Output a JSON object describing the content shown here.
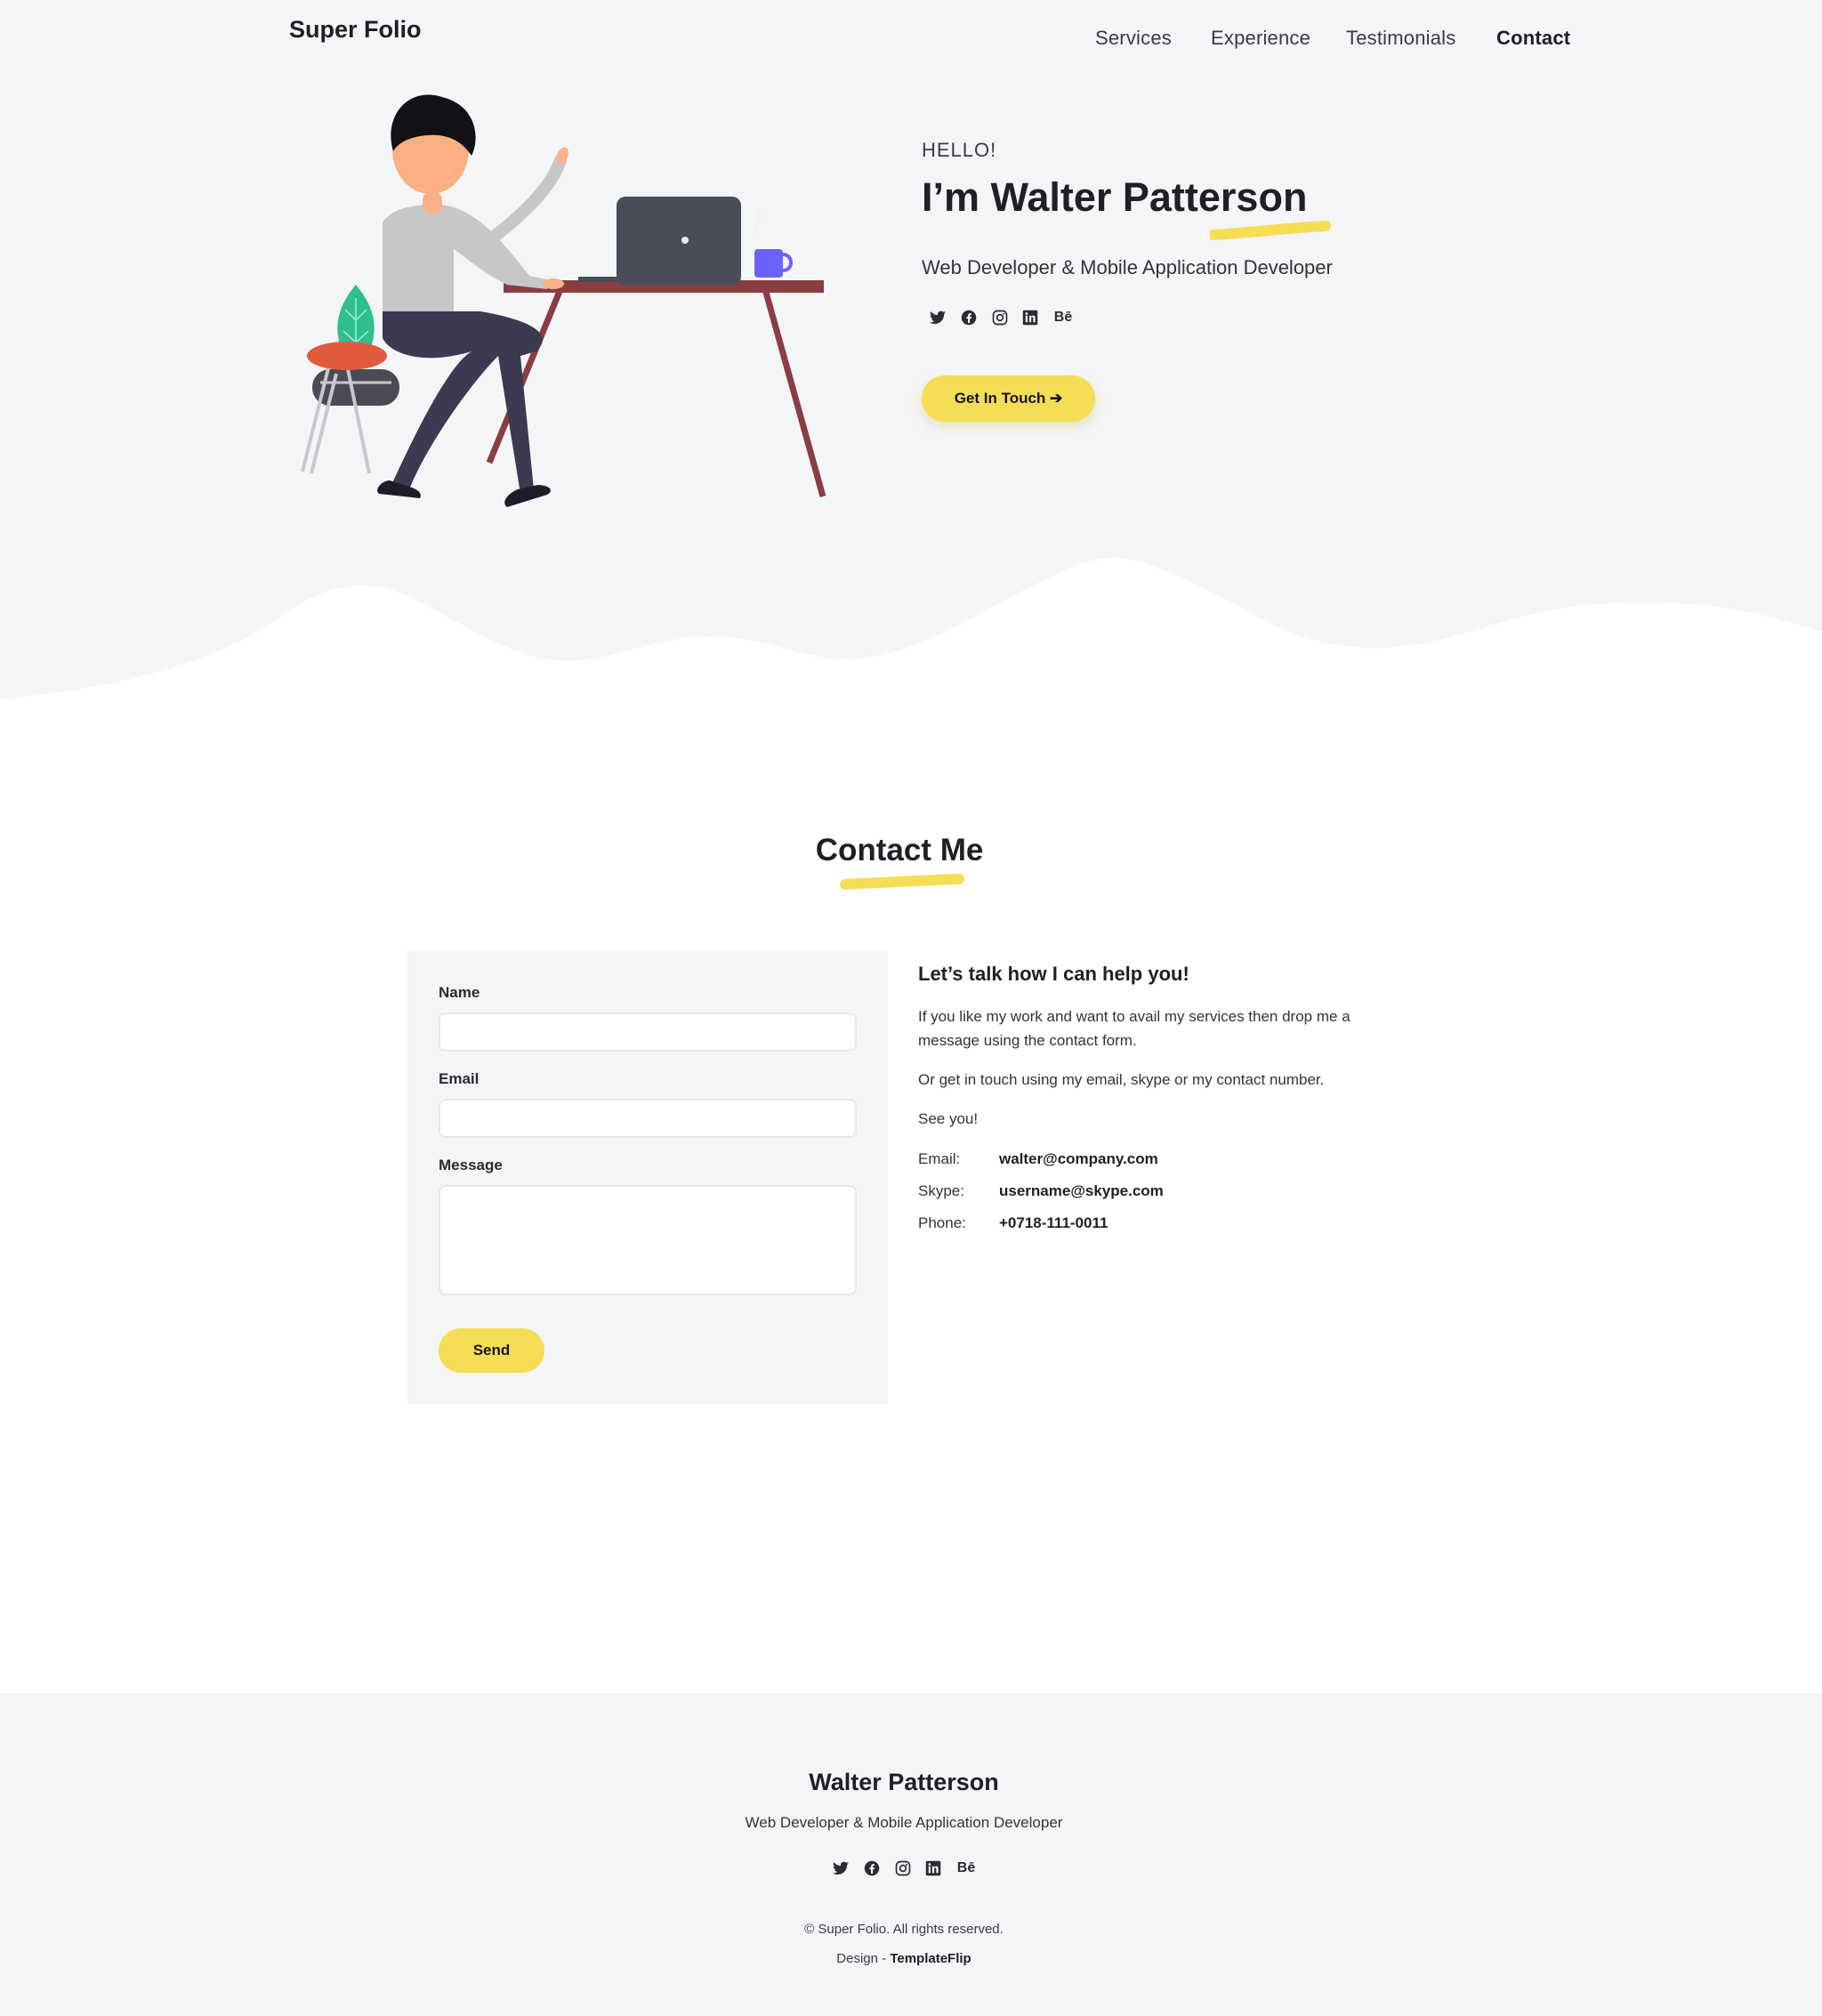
{
  "brand": "Super Folio",
  "nav": {
    "items": [
      {
        "label": "Services"
      },
      {
        "label": "Experience"
      },
      {
        "label": "Testimonials"
      },
      {
        "label": "Contact",
        "active": true
      }
    ]
  },
  "hero": {
    "greeting": "HELLO!",
    "name": "I’m Walter Patterson",
    "subtitle": "Web Developer & Mobile Application Developer",
    "cta_label": "Get In Touch",
    "cta_arrow": "➔"
  },
  "socials": [
    {
      "icon": "twitter-icon"
    },
    {
      "icon": "facebook-icon"
    },
    {
      "icon": "instagram-icon"
    },
    {
      "icon": "linkedin-icon"
    },
    {
      "icon": "behance-icon",
      "glyph": "Bē"
    }
  ],
  "contact": {
    "title": "Contact Me",
    "form": {
      "name_label": "Name",
      "email_label": "Email",
      "message_label": "Message",
      "name_value": "",
      "email_value": "",
      "message_value": "",
      "send_label": "Send"
    },
    "info": {
      "heading": "Let’s talk how I can help you!",
      "p1": "If you like my work and want to avail my services then drop me a message using the contact form.",
      "p2": "Or get in touch using my email, skype or my contact number.",
      "p3": "See you!",
      "email_label": "Email:",
      "email_value": "walter@company.com",
      "skype_label": "Skype:",
      "skype_value": "username@skype.com",
      "phone_label": "Phone:",
      "phone_value": "+0718-111-0011"
    }
  },
  "footer": {
    "name": "Walter Patterson",
    "subtitle": "Web Developer & Mobile Application Developer",
    "copyright": "© Super Folio. All rights reserved.",
    "design_prefix": "Design - ",
    "design_link": "TemplateFlip"
  },
  "colors": {
    "accent": "#f6dd56",
    "section_bg": "#f4f5f7",
    "text_dark": "#1f1f25"
  }
}
